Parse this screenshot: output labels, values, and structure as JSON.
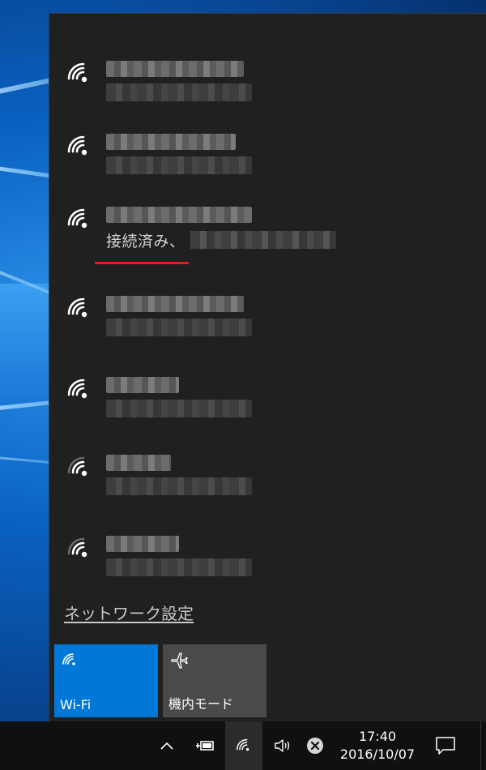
{
  "networks": [
    {
      "id": "net-1",
      "signal": "full",
      "connected": false
    },
    {
      "id": "net-2",
      "signal": "full",
      "connected": false
    },
    {
      "id": "net-3",
      "signal": "full",
      "connected": true,
      "status": "接続済み、"
    },
    {
      "id": "net-4",
      "signal": "full",
      "connected": false
    },
    {
      "id": "net-5",
      "signal": "full",
      "connected": false
    },
    {
      "id": "net-6",
      "signal": "medium",
      "connected": false
    },
    {
      "id": "net-7",
      "signal": "medium",
      "connected": false
    }
  ],
  "settings_link": "ネットワーク設定",
  "quick_actions": {
    "wifi": {
      "label": "Wi-Fi",
      "icon": "wifi-icon",
      "color": "#0078d7"
    },
    "airplane": {
      "label": "機内モード",
      "icon": "airplane-icon",
      "color": "#4a4a4a"
    }
  },
  "taskbar": {
    "time": "17:40",
    "date": "2016/10/07",
    "icons": [
      "chevron-up-icon",
      "power-icon",
      "wifi-icon",
      "volume-icon",
      "error-icon",
      "notification-icon"
    ]
  },
  "colors": {
    "flyout_bg": "#202020",
    "accent": "#0078d7",
    "highlight_underline": "#e31b1b",
    "taskbar_bg": "#101010"
  }
}
